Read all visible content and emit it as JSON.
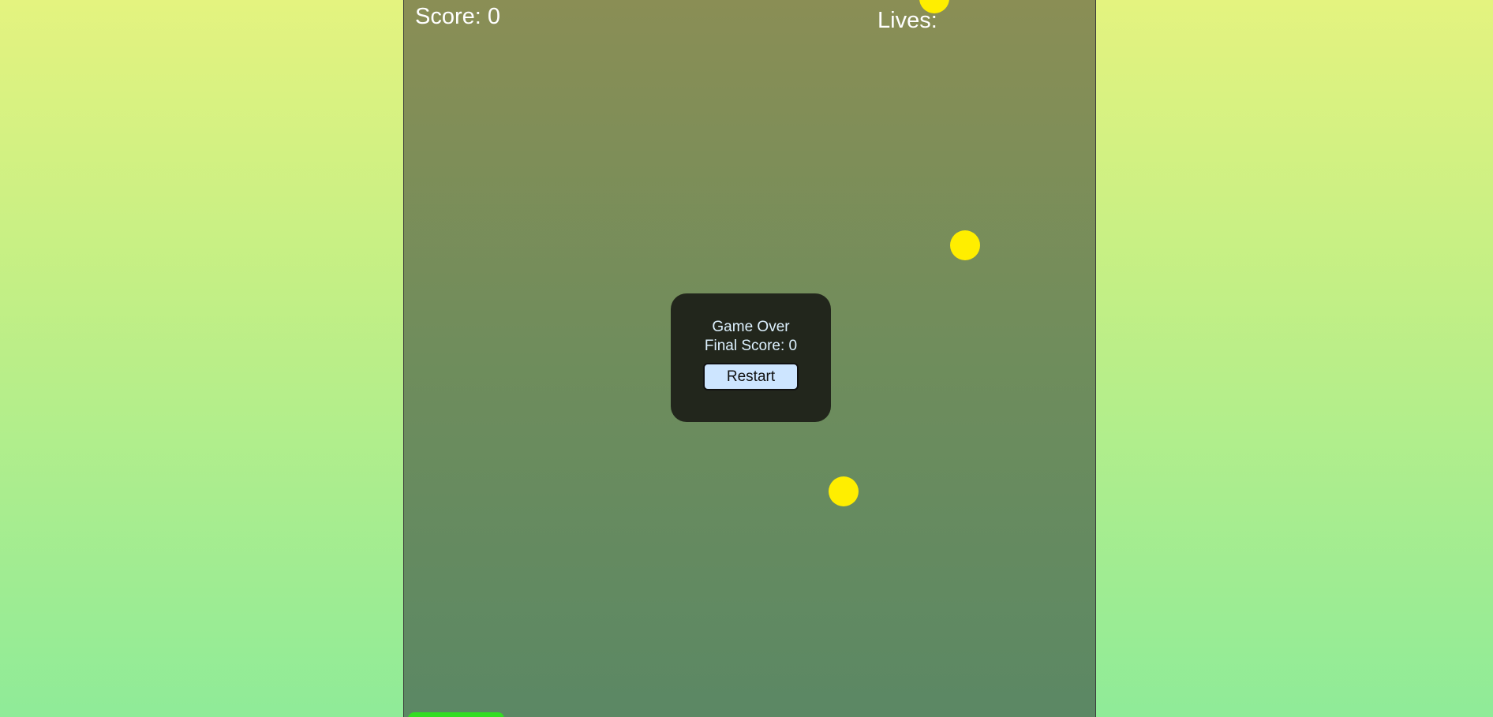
{
  "hud": {
    "score_text": "Score: 0",
    "lives_text": "Lives:"
  },
  "objects": {
    "ball_icon": "circle-icon",
    "ball_color": "#ffee00",
    "paddle_color": "#33dd22"
  },
  "game_over": {
    "title": "Game Over",
    "final_score_text": "Final Score: 0",
    "restart_label": "Restart"
  },
  "colors": {
    "background_top": "#e4f37f",
    "background_bottom": "#8feb98",
    "game_area_top": "#8a8e55",
    "game_area_bottom": "#5b8864",
    "dialog_background": "#22261c",
    "dialog_text": "#ddf1ff",
    "button_background": "#cde5ff"
  }
}
